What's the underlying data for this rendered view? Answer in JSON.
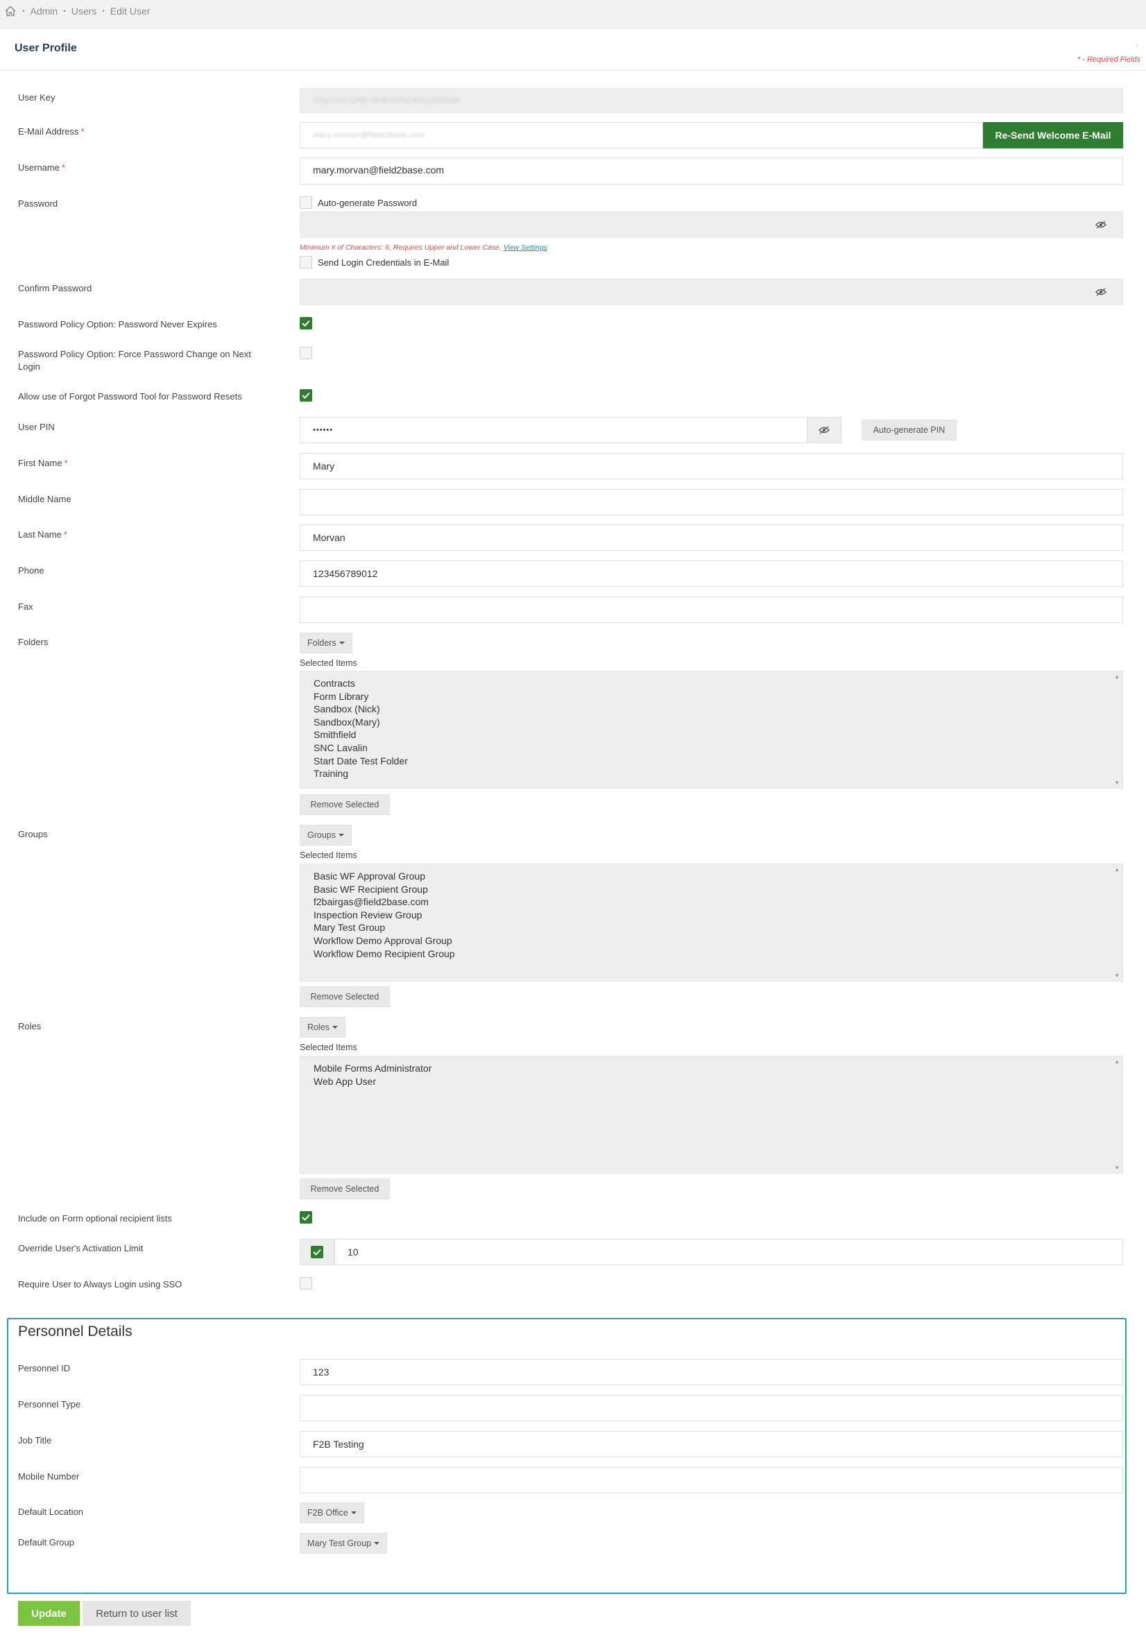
{
  "breadcrumb": {
    "items": [
      "Admin",
      "Users",
      "Edit User"
    ]
  },
  "panel": {
    "title": "User Profile",
    "required_note": "* - Required Fields"
  },
  "form": {
    "user_key": {
      "label": "User Key",
      "value": "1f3e7ac0-1d9b-4b5f-8c8d-3f2b1f9d6a8c"
    },
    "email": {
      "label": "E-Mail Address",
      "value": "mary.morvan@field2base.com",
      "resend_label": "Re-Send Welcome E-Mail"
    },
    "username": {
      "label": "Username",
      "value": "mary.morvan@field2base.com"
    },
    "password": {
      "label": "Password",
      "auto_generate_label": "Auto-generate Password",
      "hint": "Minimum # of Characters: 6, Requires Upper and Lower Case.",
      "hint_link": "View Settings",
      "send_credentials_label": "Send Login Credentials in E-Mail"
    },
    "confirm_password": {
      "label": "Confirm Password"
    },
    "never_expires": {
      "label": "Password Policy Option: Password Never Expires",
      "checked": true
    },
    "force_change": {
      "label": "Password Policy Option: Force Password Change on Next Login",
      "checked": false
    },
    "forgot_tool": {
      "label": "Allow use of Forgot Password Tool for Password Resets",
      "checked": true
    },
    "user_pin": {
      "label": "User PIN",
      "value": "••••••",
      "auto_pin_label": "Auto-generate PIN"
    },
    "first_name": {
      "label": "First Name",
      "value": "Mary"
    },
    "middle_name": {
      "label": "Middle Name",
      "value": ""
    },
    "last_name": {
      "label": "Last Name",
      "value": "Morvan"
    },
    "phone": {
      "label": "Phone",
      "value": "123456789012"
    },
    "fax": {
      "label": "Fax",
      "value": ""
    },
    "folders": {
      "label": "Folders",
      "button": "Folders",
      "selected_label": "Selected Items",
      "remove_label": "Remove Selected",
      "items": [
        "Contracts",
        "Form Library",
        "Sandbox (Nick)",
        "Sandbox(Mary)",
        "Smithfield",
        "SNC Lavalin",
        "Start Date Test Folder",
        "Training"
      ]
    },
    "groups": {
      "label": "Groups",
      "button": "Groups",
      "selected_label": "Selected Items",
      "remove_label": "Remove Selected",
      "items": [
        "Basic WF Approval Group",
        "Basic WF Recipient Group",
        "f2bairgas@field2base.com",
        "Inspection Review Group",
        "Mary Test Group",
        "Workflow Demo Approval Group",
        "Workflow Demo Recipient Group"
      ]
    },
    "roles": {
      "label": "Roles",
      "button": "Roles",
      "selected_label": "Selected Items",
      "remove_label": "Remove Selected",
      "items": [
        "Mobile Forms Administrator",
        "Web App User"
      ]
    },
    "include_optional": {
      "label": "Include on Form optional recipient lists",
      "checked": true
    },
    "override_limit": {
      "label": "Override User's Activation Limit",
      "checked": true,
      "value": "10"
    },
    "require_sso": {
      "label": "Require User to Always Login using SSO",
      "checked": false
    }
  },
  "personnel": {
    "title": "Personnel Details",
    "personnel_id": {
      "label": "Personnel ID",
      "value": "123"
    },
    "personnel_type": {
      "label": "Personnel Type",
      "value": ""
    },
    "job_title": {
      "label": "Job Title",
      "value": "F2B Testing"
    },
    "mobile_number": {
      "label": "Mobile Number",
      "value": ""
    },
    "default_location": {
      "label": "Default Location",
      "value": "F2B Office"
    },
    "default_group": {
      "label": "Default Group",
      "value": "Mary Test Group"
    }
  },
  "actions": {
    "update": "Update",
    "return": "Return to user list"
  },
  "colors": {
    "accent_green": "#2e7d32",
    "update_green": "#7cc243",
    "required_red": "#e14c4c",
    "highlight_teal": "#2f9ea8"
  }
}
